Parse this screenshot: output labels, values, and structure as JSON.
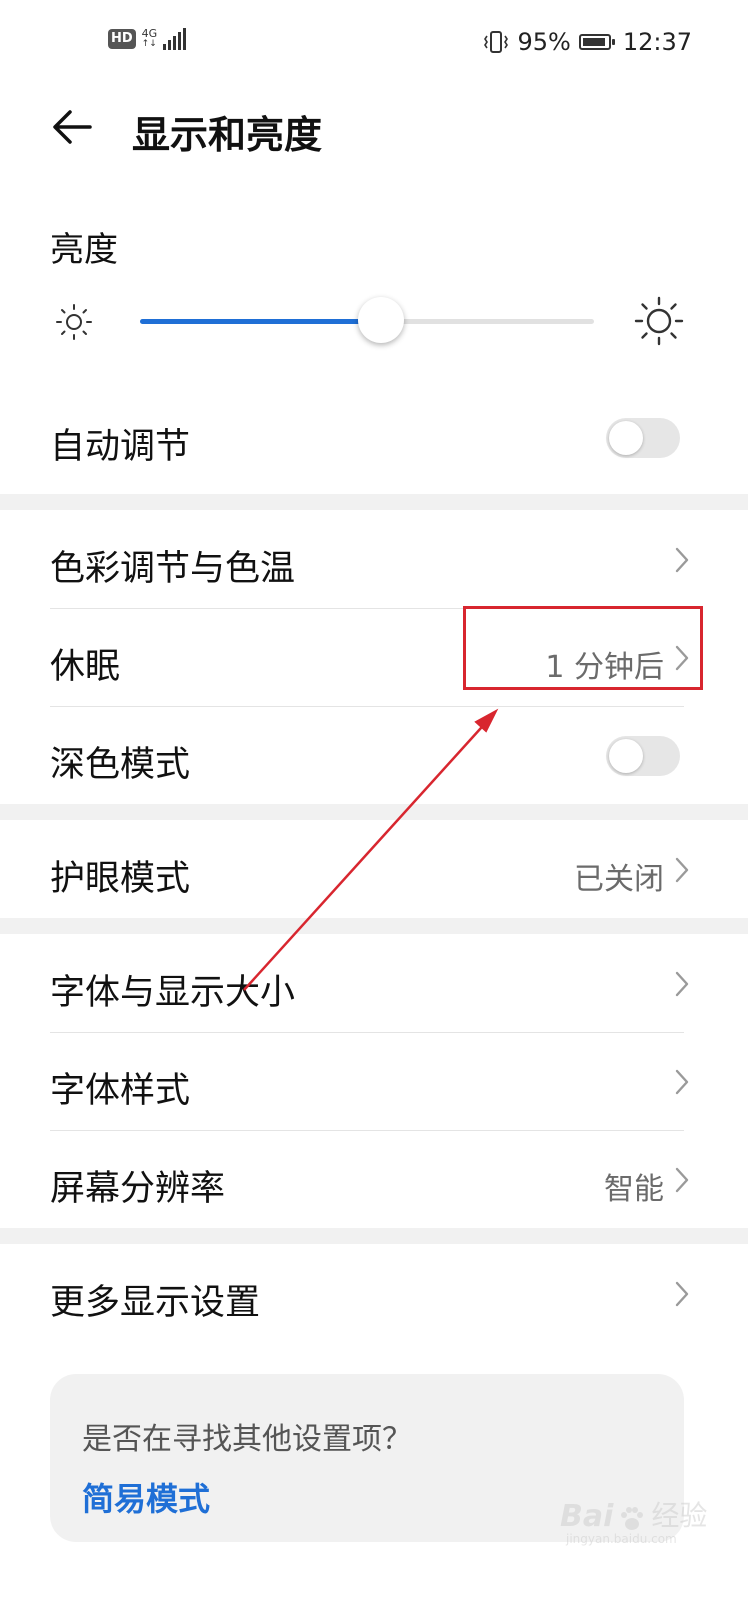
{
  "status_bar": {
    "hd_badge": "HD",
    "network": "4G",
    "battery_percent": "95%",
    "battery_level": 0.95,
    "time": "12:37"
  },
  "header": {
    "back_icon": "arrow-left-icon",
    "title": "显示和亮度"
  },
  "brightness": {
    "label": "亮度",
    "level": 0.53,
    "min_icon": "sun-small-icon",
    "max_icon": "sun-large-icon"
  },
  "settings": {
    "auto_adjust": {
      "label": "自动调节",
      "enabled": false
    },
    "color_temp": {
      "label": "色彩调节与色温"
    },
    "sleep": {
      "label": "休眠",
      "value": "1 分钟后"
    },
    "dark_mode": {
      "label": "深色模式",
      "enabled": false
    },
    "eye_comfort": {
      "label": "护眼模式",
      "value": "已关闭"
    },
    "font_display_size": {
      "label": "字体与显示大小"
    },
    "font_style": {
      "label": "字体样式"
    },
    "resolution": {
      "label": "屏幕分辨率",
      "value": "智能"
    },
    "more_display": {
      "label": "更多显示设置"
    }
  },
  "suggestion_card": {
    "question": "是否在寻找其他设置项？",
    "link": "简易模式"
  },
  "watermark": {
    "brand": "Bai",
    "brand_suffix": "经验",
    "url": "jingyan.baidu.com"
  },
  "colors": {
    "accent": "#1f6fd6",
    "annotation": "#d8262f",
    "section_band": "#f1f1f1"
  }
}
